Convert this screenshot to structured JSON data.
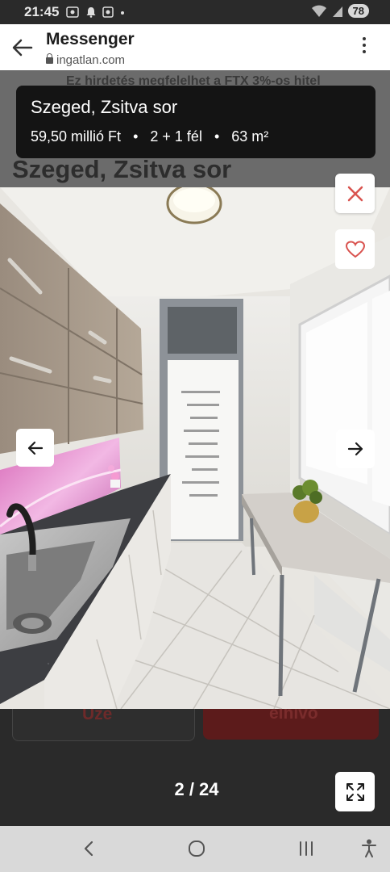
{
  "status_bar": {
    "time": "21:45",
    "notification_icons": [
      "screenshot-icon",
      "bell-icon",
      "gallery-icon",
      "dot-icon"
    ],
    "battery": "78"
  },
  "header": {
    "title": "Messenger",
    "url": "ingatlan.com"
  },
  "background_page": {
    "banner_text": "Ez hirdetés megfelelhet a FTX 3%-os hitel",
    "title": "Szeged, Zsitva sor",
    "contact_label": "Üze",
    "call_label": "elhívo"
  },
  "listing": {
    "title": "Szeged, Zsitva sor",
    "price": "59,50 millió Ft",
    "rooms": "2 + 1 fél",
    "area": "63 m²",
    "separator": "•"
  },
  "gallery": {
    "current": "2",
    "total": "24",
    "counter_text": "2 / 24"
  },
  "colors": {
    "accent": "#d9534f",
    "card_bg": "#141414"
  }
}
